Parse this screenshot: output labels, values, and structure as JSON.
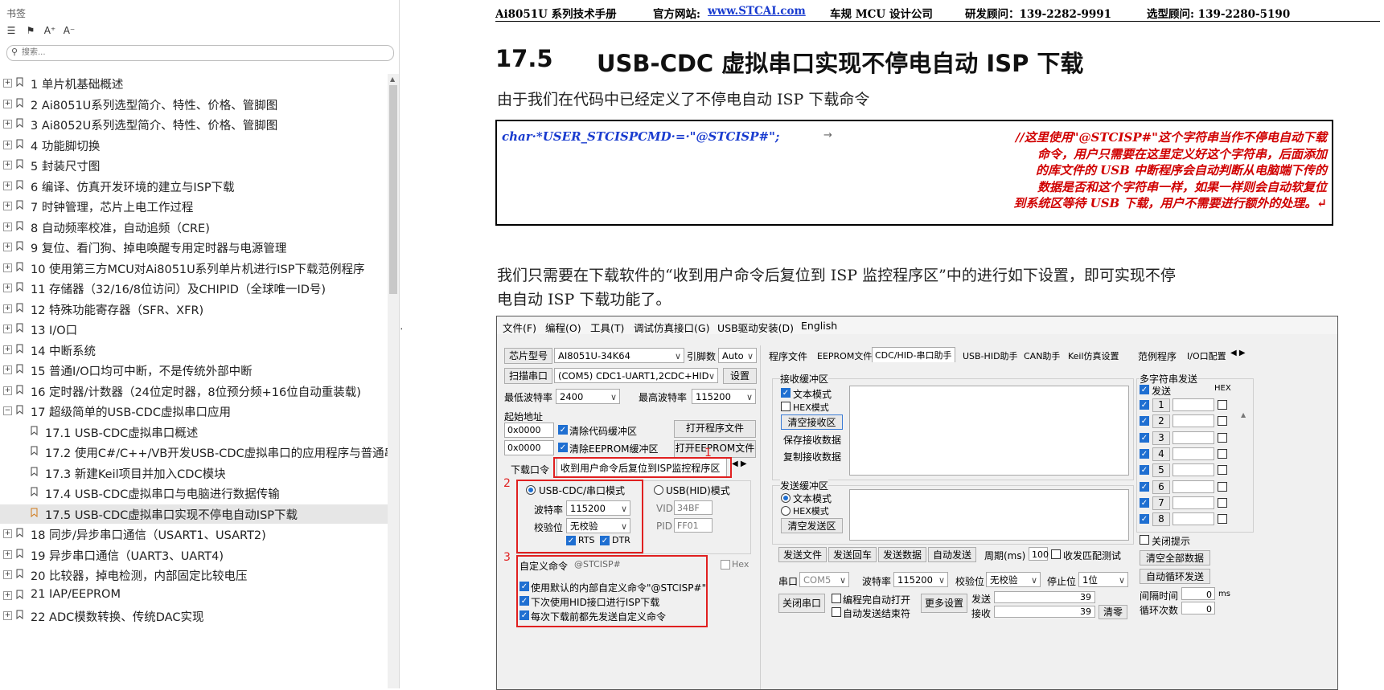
{
  "sidebar": {
    "title": "书签",
    "tools": [
      "list-icon",
      "bookmark-add-icon",
      "font-increase-icon",
      "font-decrease-icon"
    ],
    "search_placeholder": "搜索...",
    "items": [
      {
        "label": "1 单片机基础概述"
      },
      {
        "label": "2  Ai8051U系列选型简介、特性、价格、管脚图"
      },
      {
        "label": "3  Ai8052U系列选型简介、特性、价格、管脚图"
      },
      {
        "label": "4  功能脚切换"
      },
      {
        "label": "5  封装尺寸图"
      },
      {
        "label": "6  编译、仿真开发环境的建立与ISP下载"
      },
      {
        "label": "7  时钟管理，芯片上电工作过程"
      },
      {
        "label": "8  自动频率校准，自动追频（CRE)"
      },
      {
        "label": "9  复位、看门狗、掉电唤醒专用定时器与电源管理"
      },
      {
        "label": "10  使用第三方MCU对Ai8051U系列单片机进行ISP下载范例程序"
      },
      {
        "label": "11  存储器（32/16/8位访问）及CHIPID（全球唯一ID号)"
      },
      {
        "label": "12  特殊功能寄存器（SFR、XFR)"
      },
      {
        "label": "13  I/O口"
      },
      {
        "label": "14  中断系统"
      },
      {
        "label": "15  普通I/O口均可中断，不是传统外部中断"
      },
      {
        "label": "16  定时器/计数器（24位定时器，8位预分频+16位自动重装载)"
      },
      {
        "label": "17  超级简单的USB-CDC虚拟串口应用"
      },
      {
        "label": "17.1 USB-CDC虚拟串口概述"
      },
      {
        "label": "17.2  使用C#/C++/VB开发USB-CDC虚拟串口的应用程序与普通串"
      },
      {
        "label": "17.3  新建Keil项目并加入CDC模块"
      },
      {
        "label": "17.4  USB-CDC虚拟串口与电脑进行数据传输"
      },
      {
        "label": "17.5  USB-CDC虚拟串口实现不停电自动ISP下载"
      },
      {
        "label": "18  同步/异步串口通信（USART1、USART2)"
      },
      {
        "label": "19  异步串口通信（UART3、UART4)"
      },
      {
        "label": "20  比较器，掉电检测，内部固定比较电压"
      },
      {
        "label": "21  IAP/EEPROM"
      },
      {
        "label": "22  ADC模数转换、传统DAC实现"
      }
    ]
  },
  "doc": {
    "header": {
      "manual": "Ai8051U 系列技术手册",
      "site_label": "官方网站:",
      "site": "www.STCAI.com",
      "company": "车规 MCU 设计公司",
      "consult": "研发顾问：139-2282-9991",
      "select": "选型顾问: 139-2280-5190"
    },
    "heading_num": "17.5",
    "heading_text": "USB-CDC 虚拟串口实现不停电自动 ISP 下载",
    "para1": "由于我们在代码中已经定义了不停电自动 ISP 下载命令",
    "code_left": "char·*USER_STCISPCMD·=·\"@STCISP#\";",
    "code_arrow": "→",
    "code_comment": [
      "//这里使用\"@STCISP#\"这个字符串当作不停电自动下载",
      "命令，用户只需要在这里定义好这个字符串，后面添加",
      "的库文件的 USB 中断程序会自动判断从电脑端下传的",
      "数据是否和这个字符串一样，如果一样则会自动软复位",
      "到系统区等待 USB 下载，用户不需要进行额外的处理。↵"
    ],
    "para2a": "我们只需要在下载软件的“收到用户命令后复位到 ISP 监控程序区”中的进行如下设置，即可实现不停",
    "para2b": "电自动 ISP 下载功能了。"
  },
  "app": {
    "menu": [
      "文件(F)",
      "编程(O)",
      "工具(T)",
      "调试仿真接口(G)",
      "USB驱动安装(D)",
      "English"
    ],
    "chip_label": "芯片型号",
    "chip_value": "AI8051U-34K64",
    "pins_label": "引脚数",
    "pins_value": "Auto",
    "scan_btn": "扫描串口",
    "port_value": "(COM5) CDC1-UART1,2CDC+HID",
    "settings_btn": "设置",
    "min_baud_label": "最低波特率",
    "min_baud": "2400",
    "max_baud_label": "最高波特率",
    "max_baud": "115200",
    "start_addr_label": "起始地址",
    "addr1": "0x0000",
    "clear_code": "清除代码缓冲区",
    "open_prog": "打开程序文件",
    "addr2": "0x0000",
    "clear_eeprom": "清除EEPROM缓冲区",
    "open_eeprom": "打开EEPROM文件",
    "dl_tab": "下载口令",
    "reset_tab": "收到用户命令后复位到ISP监控程序区",
    "num1": "1",
    "num2": "2",
    "num3": "3",
    "usb_cdc_mode": "USB-CDC/串口模式",
    "usb_hid_mode": "USB(HID)模式",
    "baud_label": "波特率",
    "baud_value": "115200",
    "parity_label": "校验位",
    "parity_value": "无校验",
    "rts": "RTS",
    "dtr": "DTR",
    "vid_label": "VID",
    "vid": "34BF",
    "pid_label": "PID",
    "pid": "FF01",
    "custom_cmd_label": "自定义命令",
    "custom_cmd": "@STCISP#",
    "hex_label": "Hex",
    "opt1": "使用默认的内部自定义命令\"@STCISP#\"",
    "opt2": "下次使用HID接口进行ISP下载",
    "opt3": "每次下载前都先发送自定义命令",
    "tabs": [
      "程序文件",
      "EEPROM文件",
      "CDC/HID-串口助手",
      "USB-HID助手",
      "CAN助手",
      "Keil仿真设置",
      "范例程序",
      "I/O口配置"
    ],
    "recv_group": "接收缓冲区",
    "text_mode": "文本模式",
    "hex_mode": "HEX模式",
    "clear_recv": "清空接收区",
    "save_recv": "保存接收数据",
    "copy_recv": "复制接收数据",
    "send_group": "发送缓冲区",
    "clear_send": "清空发送区",
    "multi_group": "多字符串发送",
    "send_label": "发送",
    "hex_col": "HEX",
    "multi_rows": [
      "1",
      "2",
      "3",
      "4",
      "5",
      "6",
      "7",
      "8"
    ],
    "close_tip": "关闭提示",
    "clear_all": "清空全部数据",
    "auto_loop": "自动循环发送",
    "interval_label": "间隔时间",
    "interval_value": "0",
    "interval_unit": "ms",
    "loop_label": "循环次数",
    "loop_value": "0",
    "send_file": "发送文件",
    "send_cr": "发送回车",
    "send_data": "发送数据",
    "auto_send": "自动发送",
    "period_label": "周期(ms)",
    "period_value": "100",
    "match_test": "收发匹配测试",
    "port_label": "串口",
    "port_sel": "COM5",
    "baud2_label": "波特率",
    "baud2": "115200",
    "parity2_label": "校验位",
    "parity2": "无校验",
    "stop_label": "停止位",
    "stop": "1位",
    "close_port": "关闭串口",
    "auto_open": "编程完自动打开",
    "auto_end": "自动发送结束符",
    "more_settings": "更多设置",
    "sent_label": "发送",
    "sent_count": "39",
    "recv_label": "接收",
    "recv_count": "39",
    "clear_count": "清零"
  }
}
